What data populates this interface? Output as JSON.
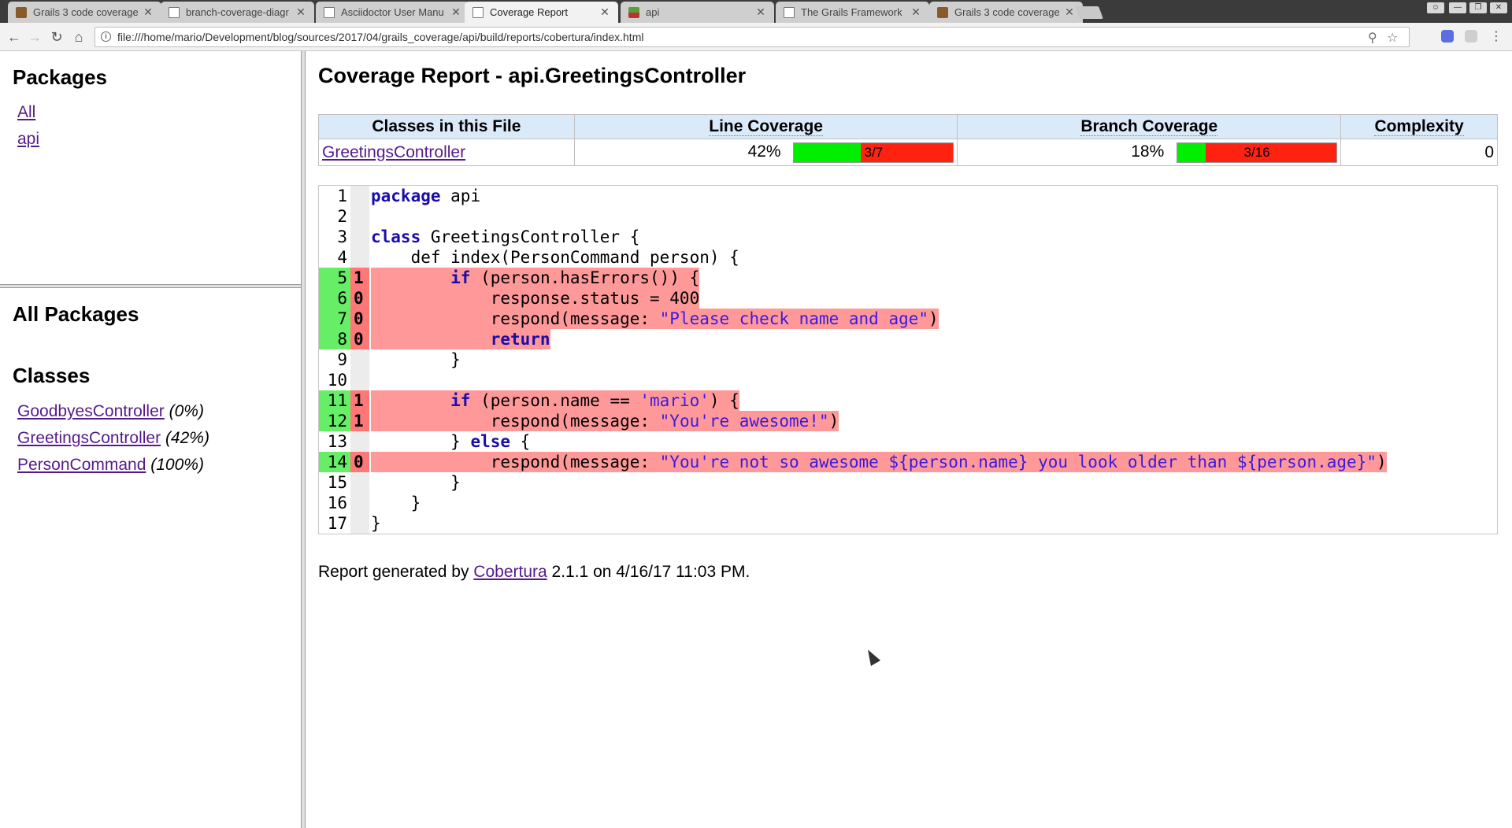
{
  "browser": {
    "tabs": [
      {
        "title": "Grails 3 code coverage",
        "icon": "grails-icon"
      },
      {
        "title": "branch-coverage-diagr",
        "icon": "document-icon"
      },
      {
        "title": "Asciidoctor User Manu",
        "icon": "document-icon"
      },
      {
        "title": "Coverage Report",
        "icon": "document-icon",
        "active": true
      },
      {
        "title": "api",
        "icon": "image-icon"
      },
      {
        "title": "The Grails Framework",
        "icon": "document-icon"
      },
      {
        "title": "Grails 3 code coverage",
        "icon": "grails-icon"
      }
    ],
    "url": "file:///home/mario/Development/blog/sources/2017/04/grails_coverage/api/build/reports/cobertura/index.html"
  },
  "packages_frame": {
    "heading": "Packages",
    "links": [
      "All",
      "api"
    ]
  },
  "classes_frame": {
    "heading": "All Packages",
    "subheading": "Classes",
    "classes": [
      {
        "name": "GoodbyesController",
        "pct": "(0%)"
      },
      {
        "name": "GreetingsController",
        "pct": "(42%)"
      },
      {
        "name": "PersonCommand",
        "pct": "(100%)"
      }
    ]
  },
  "report": {
    "title": "Coverage Report - api.GreetingsController",
    "headers": {
      "classes": "Classes in this File",
      "line": "Line Coverage",
      "branch": "Branch Coverage",
      "complexity": "Complexity"
    },
    "row": {
      "class_name": "GreetingsController",
      "line_pct": "42%",
      "line_ratio": "3/7",
      "line_fill": 0.42,
      "branch_pct": "18%",
      "branch_ratio": "3/16",
      "branch_fill": 0.18,
      "complexity": "0"
    }
  },
  "source_lines": [
    {
      "n": "1",
      "hits": "",
      "covered": false,
      "code": "package api"
    },
    {
      "n": "2",
      "hits": "",
      "covered": false,
      "code": ""
    },
    {
      "n": "3",
      "hits": "",
      "covered": false,
      "code": "class GreetingsController {"
    },
    {
      "n": "4",
      "hits": "",
      "covered": false,
      "code": "    def index(PersonCommand person) {"
    },
    {
      "n": "5",
      "hits": "1",
      "covered": true,
      "code": "        if (person.hasErrors()) {"
    },
    {
      "n": "6",
      "hits": "0",
      "covered": true,
      "code": "            response.status = 400"
    },
    {
      "n": "7",
      "hits": "0",
      "covered": true,
      "code": "            respond(message: \"Please check name and age\")"
    },
    {
      "n": "8",
      "hits": "0",
      "covered": true,
      "code": "            return"
    },
    {
      "n": "9",
      "hits": "",
      "covered": false,
      "code": "        }"
    },
    {
      "n": "10",
      "hits": "",
      "covered": false,
      "code": ""
    },
    {
      "n": "11",
      "hits": "1",
      "covered": true,
      "code": "        if (person.name == 'mario') {"
    },
    {
      "n": "12",
      "hits": "1",
      "covered": true,
      "code": "            respond(message: \"You're awesome!\")"
    },
    {
      "n": "13",
      "hits": "",
      "covered": false,
      "code": "        } else {"
    },
    {
      "n": "14",
      "hits": "0",
      "covered": true,
      "code": "            respond(message: \"You're not so awesome ${person.name} you look older than ${person.age}\")"
    },
    {
      "n": "15",
      "hits": "",
      "covered": false,
      "code": "        }"
    },
    {
      "n": "16",
      "hits": "",
      "covered": false,
      "code": "    }"
    },
    {
      "n": "17",
      "hits": "",
      "covered": false,
      "code": "}"
    }
  ],
  "footer": {
    "prefix": "Report generated by ",
    "link": "Cobertura",
    "suffix": " 2.1.1 on 4/16/17 11:03 PM."
  },
  "colors": {
    "covered_gutter": "#66ee66",
    "uncovered_code": "#ff9999",
    "bar_green": "#00ee00",
    "bar_red": "#ff2211",
    "header_bg": "#dbeaf9"
  }
}
